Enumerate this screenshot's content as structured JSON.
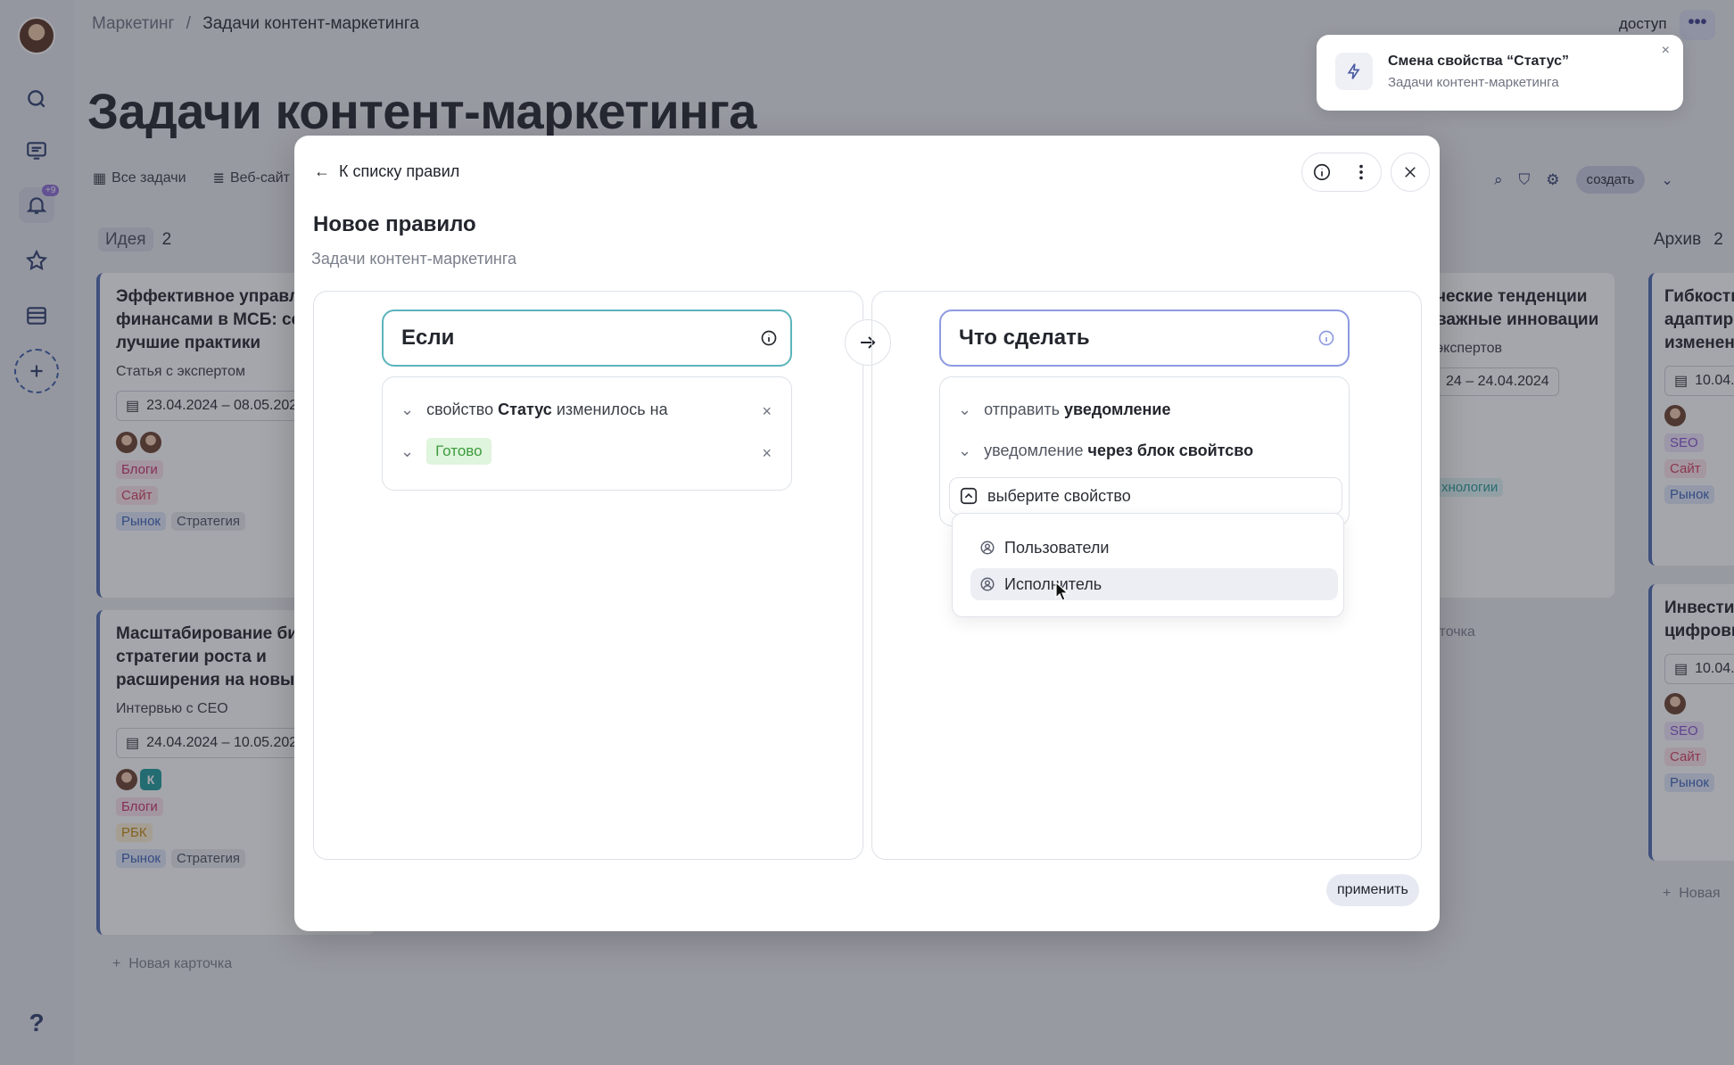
{
  "breadcrumb": {
    "parent": "Маркетинг",
    "separator": "/",
    "current": "Задачи контент-маркетинга"
  },
  "page_title": "Задачи контент-маркетинга",
  "header": {
    "access_label": "доступ",
    "more_label": "•••",
    "create_label": "создать"
  },
  "sidebar": {
    "notification_badge": "+9",
    "help_label": "?"
  },
  "views": [
    {
      "label": "Все задачи"
    },
    {
      "label": "Веб-сайт"
    }
  ],
  "columns": {
    "idea": {
      "label": "Идея",
      "count": "2"
    },
    "archive": {
      "label": "Архив",
      "count": "2"
    }
  },
  "cards": {
    "c1": {
      "title": "Эффективное управление финансами в МСБ: советы и лучшие практики",
      "sub": "Статья с экспертом",
      "date": "23.04.2024 – 08.05.2024",
      "tags": [
        "Блоги",
        "Сайт",
        "Рынок",
        "Стратегия"
      ]
    },
    "c2": {
      "title": "Масштабирование бизнеса: стратегии роста и расширения на новые",
      "sub": "Интервью с CEO",
      "date": "24.04.2024 – 10.05.2024",
      "avatar_letter": "К",
      "tags": [
        "Блоги",
        "РБК",
        "Рынок",
        "Стратегия"
      ]
    },
    "c3": {
      "title": "ческие тенденции важные инновации",
      "sub": "экспертов",
      "date": "24 – 24.04.2024",
      "tag": "хнологии"
    },
    "c4": {
      "title": "Гибкость адаптир изменен",
      "date": "10.04.",
      "tags": [
        "SEO",
        "Сайт",
        "Рынок"
      ]
    },
    "c5": {
      "title": "Инвести цифрови",
      "date": "10.04.",
      "tags": [
        "SEO",
        "Сайт",
        "Рынок"
      ]
    }
  },
  "new_card_label": "Новая карточка",
  "new_card_partial": "Новая",
  "partial_new_card_mid": "рточка",
  "toast": {
    "title": "Смена свойства “Статус”",
    "subtitle": "Задачи контент-маркетинга",
    "close": "×"
  },
  "modal": {
    "back_label": "К списку правил",
    "title": "Новое правило",
    "subtitle": "Задачи контент-маркетинга",
    "if_pane": {
      "header": "Если",
      "condition": {
        "prefix": "свойство",
        "property": "Статус",
        "suffix": "изменилось на"
      },
      "value": "Готово"
    },
    "then_pane": {
      "header": "Что сделать",
      "action1": {
        "prefix": "отправить",
        "bold": "уведомление"
      },
      "action2": {
        "prefix": "уведомление",
        "bold": "через блок свойтсво"
      },
      "select_placeholder": "выберите свойство",
      "options": [
        "Пользователи",
        "Исполнитель"
      ]
    },
    "apply_label": "применить"
  }
}
